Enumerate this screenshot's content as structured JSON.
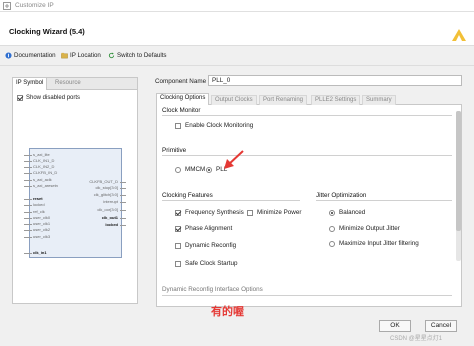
{
  "window": {
    "title": "Customize IP"
  },
  "header": {
    "title": "Clocking Wizard (5.4)"
  },
  "toolbar": {
    "documentation": "Documentation",
    "ip_location": "IP Location",
    "switch_defaults": "Switch to Defaults"
  },
  "left_panel": {
    "tabs": [
      "IP Symbol",
      "Resource"
    ],
    "show_disabled_ports": {
      "label": "Show disabled ports",
      "checked": true
    },
    "symbol": {
      "left_ports": [
        "s_axi_lite",
        "CLK_IN1_D",
        "CLK_IN2_D",
        "CLKFB_IN_D",
        "s_axi_aclk",
        "s_axi_aresetn",
        "reset",
        "locked",
        "ref_clk",
        "user_clk0",
        "user_clk1",
        "user_clk2",
        "user_clk3",
        "clk_in1"
      ],
      "right_ports": [
        "CLKFB_OUT_D",
        "clk_stop[3:0]",
        "clk_glitch[3:0]",
        "interrupt",
        "clk_oor[3:0]",
        "clk_out1",
        "locked"
      ]
    }
  },
  "right_panel": {
    "component_name_label": "Component Name",
    "component_name": "PLL_0",
    "tabs": [
      "Clocking Options",
      "Output Clocks",
      "Port Renaming",
      "PLLE2 Settings",
      "Summary"
    ],
    "active_tab": "Clocking Options",
    "clock_monitor": {
      "title": "Clock Monitor",
      "enable_label": "Enable Clock Monitoring",
      "enabled": false
    },
    "primitive": {
      "title": "Primitive",
      "options": [
        "MMCM",
        "PLL"
      ],
      "selected": "PLL"
    },
    "clocking_features": {
      "title": "Clocking Features",
      "items": [
        {
          "label": "Frequency Synthesis",
          "checked": true
        },
        {
          "label": "Minimize Power",
          "checked": false
        },
        {
          "label": "Phase Alignment",
          "checked": true
        },
        {
          "label": "Dynamic Reconfig",
          "checked": false
        },
        {
          "label": "Safe Clock Startup",
          "checked": false
        }
      ]
    },
    "jitter_optimization": {
      "title": "Jitter Optimization",
      "options": [
        "Balanced",
        "Minimize Output Jitter",
        "Maximize Input Jitter filtering"
      ],
      "selected": "Balanced"
    },
    "dynamic_reconfig": {
      "title": "Dynamic Reconfig Interface Options"
    }
  },
  "buttons": {
    "ok": "OK",
    "cancel": "Cancel"
  },
  "watermark": "有的喔",
  "credit": "CSDN @星星点灯1"
}
